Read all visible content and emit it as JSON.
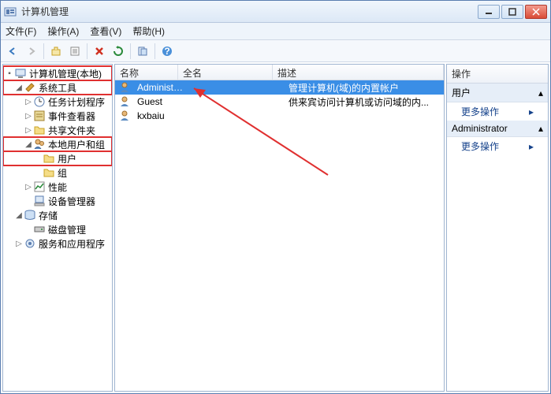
{
  "window": {
    "title": "计算机管理"
  },
  "menu": {
    "file": "文件(F)",
    "action": "操作(A)",
    "view": "查看(V)",
    "help": "帮助(H)"
  },
  "tree": {
    "root": "计算机管理(本地)",
    "sys_tools": "系统工具",
    "task_sched": "任务计划程序",
    "event_viewer": "事件查看器",
    "shared": "共享文件夹",
    "local_users": "本地用户和组",
    "users": "用户",
    "groups": "组",
    "perf": "性能",
    "devmgr": "设备管理器",
    "storage": "存储",
    "diskmgr": "磁盘管理",
    "services": "服务和应用程序"
  },
  "list": {
    "col_name": "名称",
    "col_full": "全名",
    "col_desc": "描述",
    "rows": [
      {
        "name": "Administrat...",
        "full": "",
        "desc": "管理计算机(域)的内置帐户"
      },
      {
        "name": "Guest",
        "full": "",
        "desc": "供来宾访问计算机或访问域的内..."
      },
      {
        "name": "kxbaiu",
        "full": "",
        "desc": ""
      }
    ]
  },
  "actions": {
    "title": "操作",
    "grp_users": "用户",
    "more": "更多操作",
    "grp_admin": "Administrator"
  }
}
